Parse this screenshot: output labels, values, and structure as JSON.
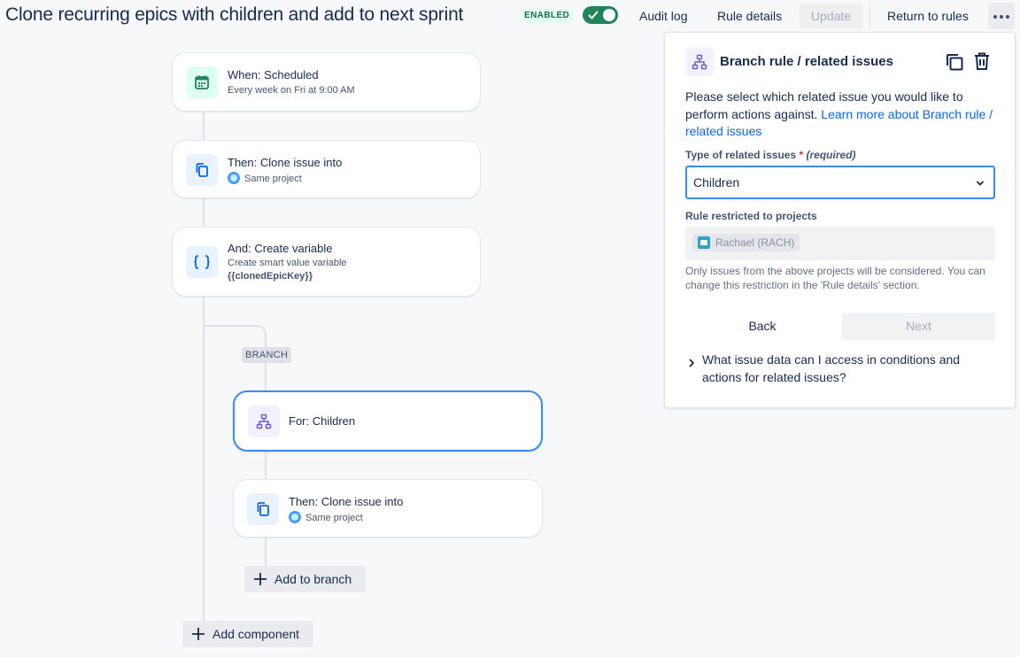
{
  "header": {
    "title": "Clone recurring epics with children and add to next sprint",
    "status_lozenge": "ENABLED",
    "toggle_on": true,
    "audit_log": "Audit log",
    "rule_details": "Rule details",
    "update": "Update",
    "return_to_rules": "Return to rules"
  },
  "flow": {
    "trigger": {
      "title": "When: Scheduled",
      "subtitle": "Every week on Fri at 9:00 AM",
      "icon": "calendar-icon"
    },
    "clone1": {
      "title": "Then: Clone issue into",
      "subtitle": "Same project",
      "icon": "copy-icon"
    },
    "variable": {
      "title": "And: Create variable",
      "subtitle": "Create smart value variable",
      "code": "{{clonedEpicKey}}",
      "icon": "braces-icon"
    },
    "branch_label": "BRANCH",
    "branch_for": {
      "title": "For: Children",
      "icon": "hierarchy-icon"
    },
    "clone2": {
      "title": "Then: Clone issue into",
      "subtitle": "Same project",
      "icon": "copy-icon"
    },
    "add_to_branch": "Add to branch",
    "add_component": "Add component"
  },
  "panel": {
    "title": "Branch rule / related issues",
    "description": "Please select which related issue you would like to perform actions against.",
    "learn_more": "Learn more about Branch rule / related issues",
    "type_label": "Type of related issues",
    "required_star": "*",
    "required_note": "(required)",
    "type_value": "Children",
    "restricted_label": "Rule restricted to projects",
    "project_tag": "Rachael (RACH)",
    "help_text": "Only issues from the above projects will be considered. You can change this restriction in the 'Rule details' section.",
    "back": "Back",
    "next": "Next",
    "faq": "What issue data can I access in conditions and actions for related issues?"
  },
  "colors": {
    "accent": "#0c66e4",
    "selected_border": "#388bff",
    "toggle_on": "#1f845a",
    "enabled_bg": "#e3fcef",
    "enabled_text": "#216e4e"
  }
}
